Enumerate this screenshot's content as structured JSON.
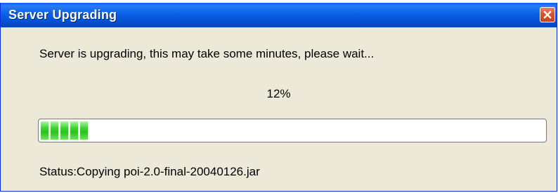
{
  "window": {
    "title": "Server Upgrading"
  },
  "dialog": {
    "message": "Server is upgrading, this may take some minutes, please wait...",
    "percent_text": "12%",
    "progress_fraction": 0.12,
    "status_text": "Status:Copying poi-2.0-final-20040126.jar"
  },
  "icons": {
    "close": "close-icon"
  },
  "colors": {
    "titlebar": "#0a5df7",
    "window_background": "#ece9d8",
    "progress_fill": "#2bc21f",
    "close_button": "#d9512b"
  }
}
